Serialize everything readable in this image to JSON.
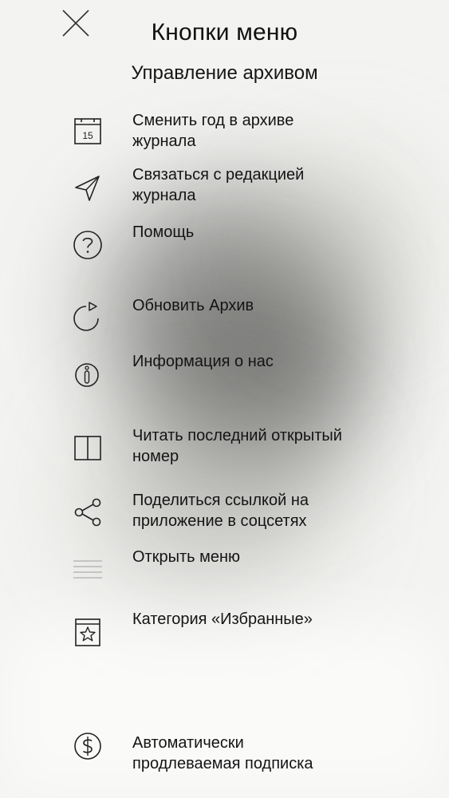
{
  "header": {
    "title": "Кнопки меню",
    "subtitle": "Управление архивом"
  },
  "close_icon": "close-icon",
  "items": [
    {
      "id": "change-year",
      "icon": "calendar-icon",
      "calendar_number": "15",
      "label_line1": "Сменить год в архиве",
      "label_line2": "журнала"
    },
    {
      "id": "contact",
      "icon": "send-icon",
      "label_line1": "Связаться с редакцией",
      "label_line2": "журнала"
    },
    {
      "id": "help",
      "icon": "help-icon",
      "label_line1": "Помощь",
      "label_line2": ""
    },
    {
      "id": "refresh",
      "icon": "refresh-icon",
      "label_line1": "Обновить Архив",
      "label_line2": ""
    },
    {
      "id": "info",
      "icon": "info-icon",
      "label_line1": "Информация о нас",
      "label_line2": ""
    },
    {
      "id": "read-last",
      "icon": "book-icon",
      "label_line1": "Читать последний открытый",
      "label_line2": "номер"
    },
    {
      "id": "share",
      "icon": "share-icon",
      "label_line1": "Поделиться ссылкой на",
      "label_line2": "приложение в соцсетях"
    },
    {
      "id": "open-menu",
      "icon": "menu-icon",
      "label_line1": "Открыть меню",
      "label_line2": ""
    },
    {
      "id": "favorites",
      "icon": "star-icon",
      "label_line1": "Категория «Избранные»",
      "label_line2": ""
    },
    {
      "id": "subscription",
      "icon": "dollar-icon",
      "label_line1": "Автоматически",
      "label_line2": "продлеваемая подписка"
    }
  ]
}
